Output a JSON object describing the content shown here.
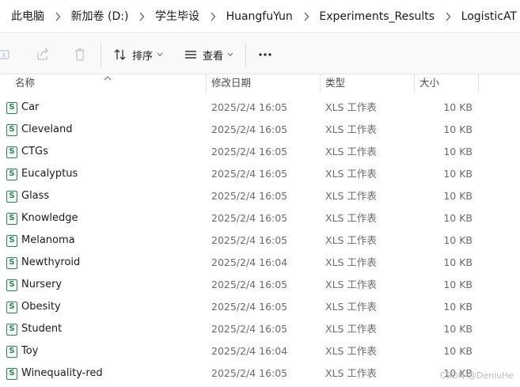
{
  "breadcrumb": {
    "items": [
      "此电脑",
      "新加卷 (D:)",
      "学生毕设",
      "HuangfuYun",
      "Experiments_Results",
      "LogisticAT"
    ]
  },
  "toolbar": {
    "rename_icon": "rename-icon",
    "share_icon": "share-icon",
    "delete_icon": "delete-icon",
    "sort_label": "排序",
    "view_label": "查看",
    "more_label": "···"
  },
  "columns": {
    "name": "名称",
    "modified": "修改日期",
    "type": "类型",
    "size": "大小"
  },
  "files": [
    {
      "name": "Car",
      "modified": "2025/2/4 16:05",
      "type": "XLS 工作表",
      "size": "10 KB"
    },
    {
      "name": "Cleveland",
      "modified": "2025/2/4 16:05",
      "type": "XLS 工作表",
      "size": "10 KB"
    },
    {
      "name": "CTGs",
      "modified": "2025/2/4 16:05",
      "type": "XLS 工作表",
      "size": "10 KB"
    },
    {
      "name": "Eucalyptus",
      "modified": "2025/2/4 16:05",
      "type": "XLS 工作表",
      "size": "10 KB"
    },
    {
      "name": "Glass",
      "modified": "2025/2/4 16:05",
      "type": "XLS 工作表",
      "size": "10 KB"
    },
    {
      "name": "Knowledge",
      "modified": "2025/2/4 16:05",
      "type": "XLS 工作表",
      "size": "10 KB"
    },
    {
      "name": "Melanoma",
      "modified": "2025/2/4 16:05",
      "type": "XLS 工作表",
      "size": "10 KB"
    },
    {
      "name": "Newthyroid",
      "modified": "2025/2/4 16:04",
      "type": "XLS 工作表",
      "size": "10 KB"
    },
    {
      "name": "Nursery",
      "modified": "2025/2/4 16:05",
      "type": "XLS 工作表",
      "size": "10 KB"
    },
    {
      "name": "Obesity",
      "modified": "2025/2/4 16:05",
      "type": "XLS 工作表",
      "size": "10 KB"
    },
    {
      "name": "Student",
      "modified": "2025/2/4 16:05",
      "type": "XLS 工作表",
      "size": "10 KB"
    },
    {
      "name": "Toy",
      "modified": "2025/2/4 16:04",
      "type": "XLS 工作表",
      "size": "10 KB"
    },
    {
      "name": "Winequality-red",
      "modified": "2025/2/4 16:05",
      "type": "XLS 工作表",
      "size": "10 KB"
    }
  ],
  "file_icon": {
    "glyph": "S",
    "color": "#1d8a4d"
  },
  "watermark": "CSDN @DeniuHe"
}
